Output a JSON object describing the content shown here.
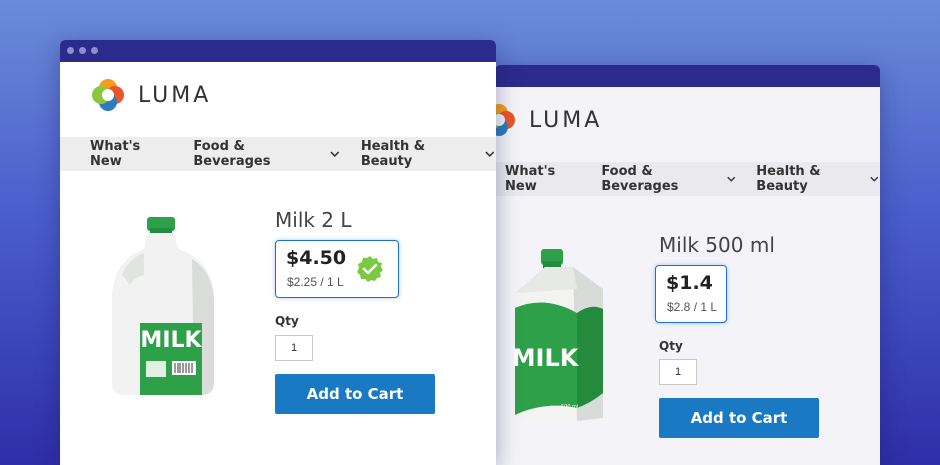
{
  "brand": {
    "name": "LUMA"
  },
  "nav": {
    "items": [
      {
        "label": "What's New",
        "has_dropdown": false
      },
      {
        "label": "Food & Beverages",
        "has_dropdown": true
      },
      {
        "label": "Health & Beauty",
        "has_dropdown": true
      }
    ]
  },
  "front_product": {
    "title": "Milk 2 L",
    "price": "$4.50",
    "unit_price": "$2.25 / 1 L",
    "qty_label": "Qty",
    "qty_value": "1",
    "add_to_cart_label": "Add to Cart",
    "image_icon": "milk-jug-icon",
    "verified_icon": "checkmark-badge-icon"
  },
  "back_product": {
    "title": "Milk 500 ml",
    "price": "$1.4",
    "unit_price": "$2.8 / 1 L",
    "qty_label": "Qty",
    "qty_value": "1",
    "add_to_cart_label": "Add to Cart",
    "image_icon": "milk-carton-icon"
  },
  "colors": {
    "accent": "#1979c3",
    "price_box_border": "#1d6fd1",
    "milk_green": "#2fa04a",
    "check_green": "#7ac943",
    "titlebar": "#2c2b8c"
  }
}
